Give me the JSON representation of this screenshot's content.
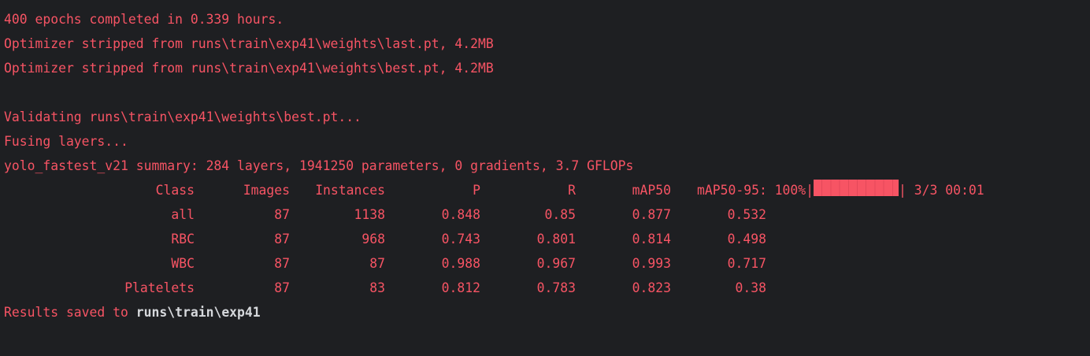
{
  "terminal": {
    "colors": {
      "background": "#1e1f22",
      "error_text": "#f75464",
      "path_highlight": "#d6d8dc"
    },
    "lines": {
      "epochs": "400 epochs completed in 0.339 hours.",
      "strip_last": "Optimizer stripped from runs\\train\\exp41\\weights\\last.pt, 4.2MB",
      "strip_best": "Optimizer stripped from runs\\train\\exp41\\weights\\best.pt, 4.2MB",
      "validating": "Validating runs\\train\\exp41\\weights\\best.pt...",
      "fusing": "Fusing layers...",
      "summary": "yolo_fastest_v21 summary: 284 layers, 1941250 parameters, 0 gradients, 3.7 GFLOPs"
    },
    "results_table": {
      "headers": {
        "class": "Class",
        "images": "Images",
        "instances": "Instances",
        "p": "P",
        "r": "R",
        "map50": "mAP50",
        "map5095": "mAP50-95: 100%|"
      },
      "progress": {
        "fraction": 1.0,
        "bar_end": "|",
        "tail": "3/3 00:01"
      },
      "rows": [
        {
          "class": "all",
          "images": "87",
          "instances": "1138",
          "p": "0.848",
          "r": "0.85",
          "map50": "0.877",
          "map5095": "0.532"
        },
        {
          "class": "RBC",
          "images": "87",
          "instances": "968",
          "p": "0.743",
          "r": "0.801",
          "map50": "0.814",
          "map5095": "0.498"
        },
        {
          "class": "WBC",
          "images": "87",
          "instances": "87",
          "p": "0.988",
          "r": "0.967",
          "map50": "0.993",
          "map5095": "0.717"
        },
        {
          "class": "Platelets",
          "images": "87",
          "instances": "83",
          "p": "0.812",
          "r": "0.783",
          "map50": "0.823",
          "map5095": "0.38"
        }
      ]
    },
    "results_saved": {
      "prefix": "Results saved to ",
      "path": "runs\\train\\exp41"
    }
  }
}
